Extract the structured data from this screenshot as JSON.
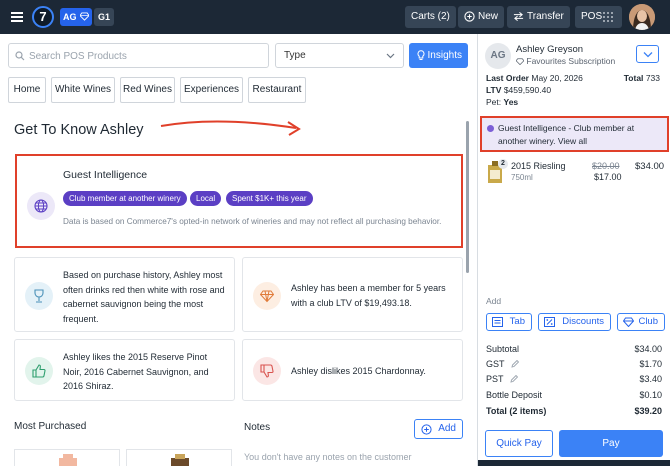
{
  "topbar": {
    "logo_text": "7",
    "badge_ag": "AG",
    "badge_g1": "G1",
    "carts_label": "Carts (2)",
    "new_label": "New",
    "transfer_label": "Transfer",
    "pos_label": "POS"
  },
  "search": {
    "placeholder": "Search POS Products"
  },
  "type_select": {
    "value": "Type"
  },
  "insights_label": "Insights",
  "nav_tabs": [
    "Home",
    "White Wines",
    "Red Wines",
    "Experiences",
    "Restaurant"
  ],
  "main": {
    "title": "Get To Know Ashley",
    "guest_intelligence": {
      "title": "Guest Intelligence",
      "tags": [
        "Club member at another winery",
        "Local",
        "Spent $1K+ this year"
      ],
      "note": "Data is based on Commerce7's opted-in network of wineries and may not reflect all purchasing behavior."
    },
    "insight_cards": [
      {
        "icon": "wine-glass-icon",
        "text": "Based on purchase history, Ashley most often drinks red then white with rose and cabernet sauvignon being the most frequent."
      },
      {
        "icon": "diamond-icon",
        "text": "Ashley has been a member for 5 years with a club LTV of $19,493.18."
      },
      {
        "icon": "thumbs-up-icon",
        "text": "Ashley likes the 2015 Reserve Pinot Noir, 2016 Cabernet Sauvignon, and 2016 Shiraz."
      },
      {
        "icon": "thumbs-down-icon",
        "text": "Ashley dislikes 2015 Chardonnay."
      }
    ],
    "most_purchased_heading": "Most Purchased",
    "notes_heading": "Notes",
    "notes_add_label": "Add",
    "notes_empty": "You don't have any notes on the customer"
  },
  "customer": {
    "initials": "AG",
    "name": "Ashley Greyson",
    "subscription": "Favourites Subscription",
    "last_order_label": "Last Order",
    "last_order_value": "May 20, 2026",
    "total_label": "Total",
    "total_value": "733",
    "ltv_label": "LTV",
    "ltv_value": "$459,590.40",
    "pet_label": "Pet:",
    "pet_value": "Yes",
    "gi_banner": "Guest Intelligence - Club member at another winery. View all"
  },
  "cart": {
    "items": [
      {
        "qty": "2",
        "name": "2015 Riesling",
        "size": "750ml",
        "price_original": "$20.00",
        "price_sale": "$17.00",
        "line_total": "$34.00"
      }
    ],
    "add_label": "Add",
    "add_buttons": [
      "Tab",
      "Discounts",
      "Club"
    ],
    "summary": [
      {
        "label": "Subtotal",
        "value": "$34.00",
        "bold": false,
        "editable": false
      },
      {
        "label": "GST",
        "value": "$1.70",
        "bold": false,
        "editable": true
      },
      {
        "label": "PST",
        "value": "$3.40",
        "bold": false,
        "editable": true
      },
      {
        "label": "Bottle Deposit",
        "value": "$0.10",
        "bold": false,
        "editable": false
      },
      {
        "label": "Total (2 items)",
        "value": "$39.20",
        "bold": true,
        "editable": false
      }
    ],
    "quick_pay_label": "Quick Pay",
    "pay_label": "Pay"
  },
  "colors": {
    "topbar_bg": "#1c2836",
    "accent_blue": "#3b82f6",
    "tag_purple": "#5b3fc4",
    "highlight_red": "#e0402a",
    "gi_banner_bg": "#ece8f8"
  }
}
